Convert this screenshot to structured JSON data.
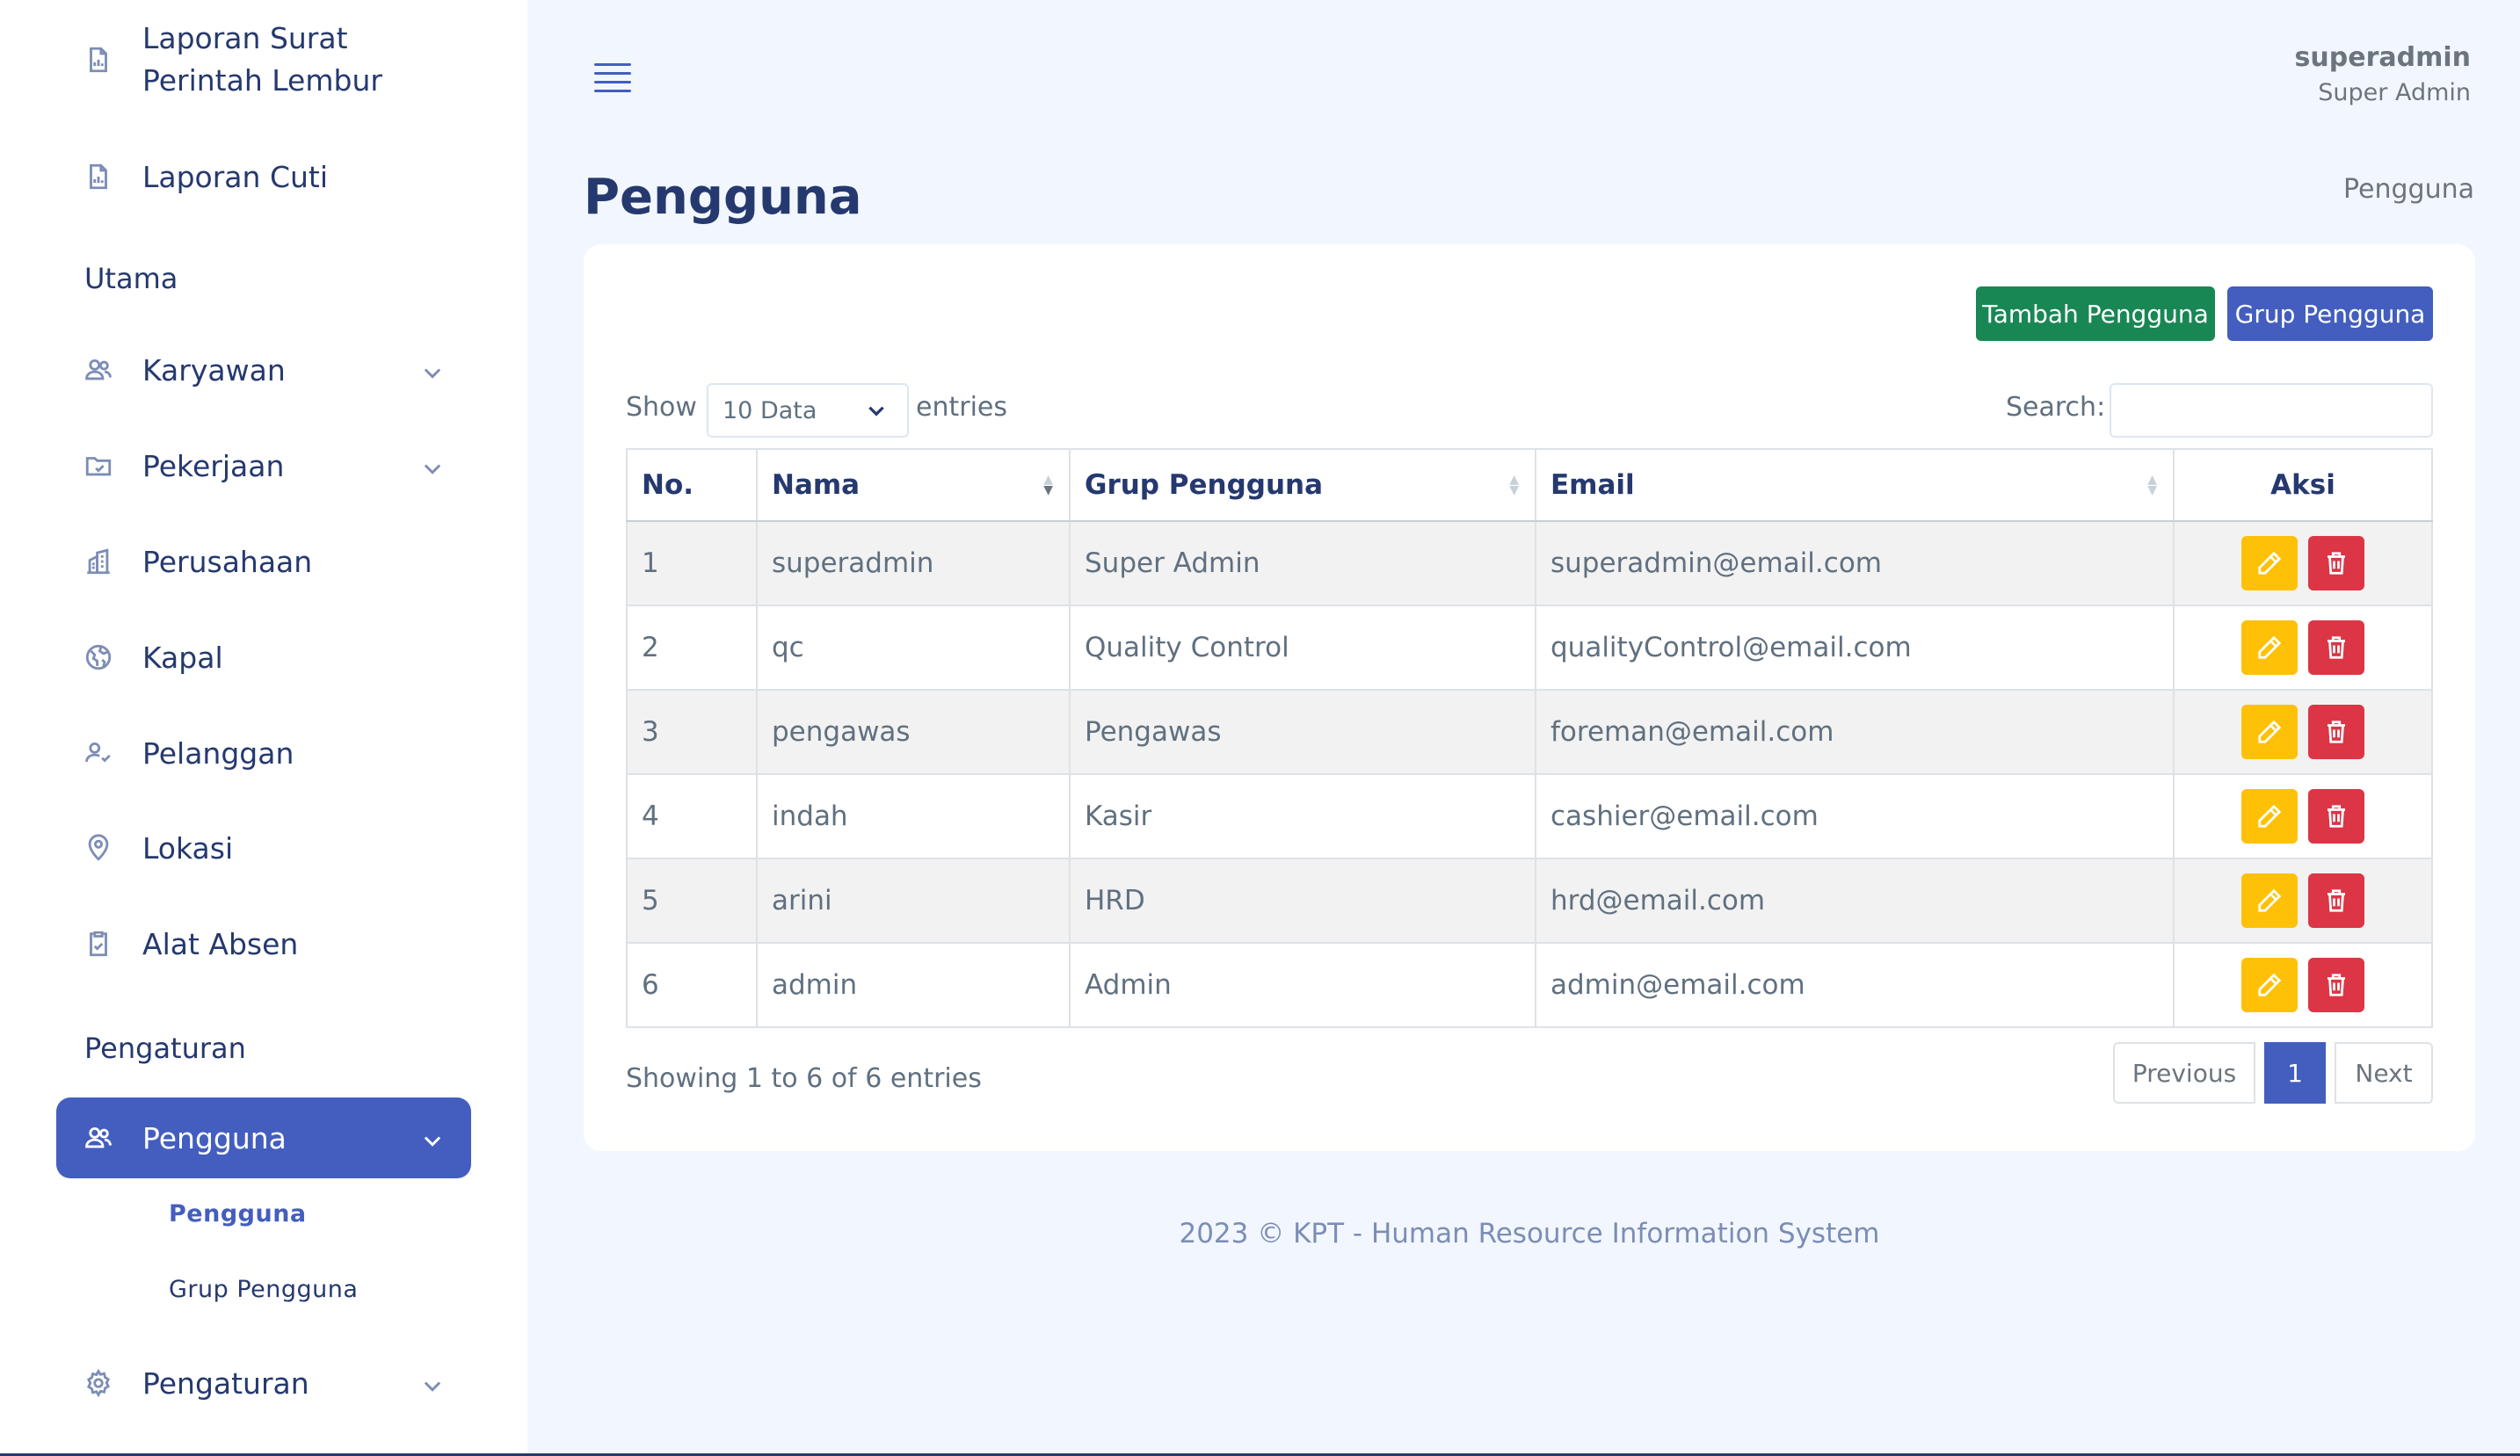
{
  "sidebar": {
    "items_top": [
      {
        "label": "Laporan Surat Perintah Lembur",
        "icon": "report-icon"
      },
      {
        "label": "Laporan Cuti",
        "icon": "report-icon"
      }
    ],
    "section_utama": "Utama",
    "utama_items": [
      {
        "label": "Karyawan",
        "icon": "people-icon",
        "expandable": true
      },
      {
        "label": "Pekerjaan",
        "icon": "folder-icon",
        "expandable": true
      },
      {
        "label": "Perusahaan",
        "icon": "building-icon",
        "expandable": false
      },
      {
        "label": "Kapal",
        "icon": "globe-icon",
        "expandable": false
      },
      {
        "label": "Pelanggan",
        "icon": "person-check-icon",
        "expandable": false
      },
      {
        "label": "Lokasi",
        "icon": "location-icon",
        "expandable": false
      },
      {
        "label": "Alat Absen",
        "icon": "clipboard-check-icon",
        "expandable": false
      }
    ],
    "section_pengaturan": "Pengaturan",
    "active_item": {
      "label": "Pengguna",
      "icon": "people-icon"
    },
    "sub_items": [
      "Pengguna",
      "Grup Pengguna"
    ],
    "settings_item": {
      "label": "Pengaturan",
      "icon": "gear-icon"
    }
  },
  "header": {
    "user_name": "superadmin",
    "user_role": "Super Admin"
  },
  "page": {
    "title": "Pengguna",
    "breadcrumb": "Pengguna"
  },
  "card": {
    "add_button": "Tambah Pengguna",
    "group_button": "Grup Pengguna",
    "show_label": "Show",
    "entries_label": "entries",
    "length_value": "10 Data",
    "search_label": "Search:",
    "search_value": ""
  },
  "table": {
    "columns": [
      "No.",
      "Nama",
      "Grup Pengguna",
      "Email",
      "Aksi"
    ],
    "rows": [
      {
        "no": "1",
        "nama": "superadmin",
        "grup": "Super Admin",
        "email": "superadmin@email.com"
      },
      {
        "no": "2",
        "nama": "qc",
        "grup": "Quality Control",
        "email": "qualityControl@email.com"
      },
      {
        "no": "3",
        "nama": "pengawas",
        "grup": "Pengawas",
        "email": "foreman@email.com"
      },
      {
        "no": "4",
        "nama": "indah",
        "grup": "Kasir",
        "email": "cashier@email.com"
      },
      {
        "no": "5",
        "nama": "arini",
        "grup": "HRD",
        "email": "hrd@email.com"
      },
      {
        "no": "6",
        "nama": "admin",
        "grup": "Admin",
        "email": "admin@email.com"
      }
    ]
  },
  "pagination": {
    "info": "Showing 1 to 6 of 6 entries",
    "previous": "Previous",
    "current": "1",
    "next": "Next"
  },
  "footer": {
    "text": "2023 © KPT - Human Resource Information System"
  },
  "colors": {
    "primary": "#435ebe",
    "success": "#198754",
    "warning": "#ffc107",
    "danger": "#dc3545"
  }
}
